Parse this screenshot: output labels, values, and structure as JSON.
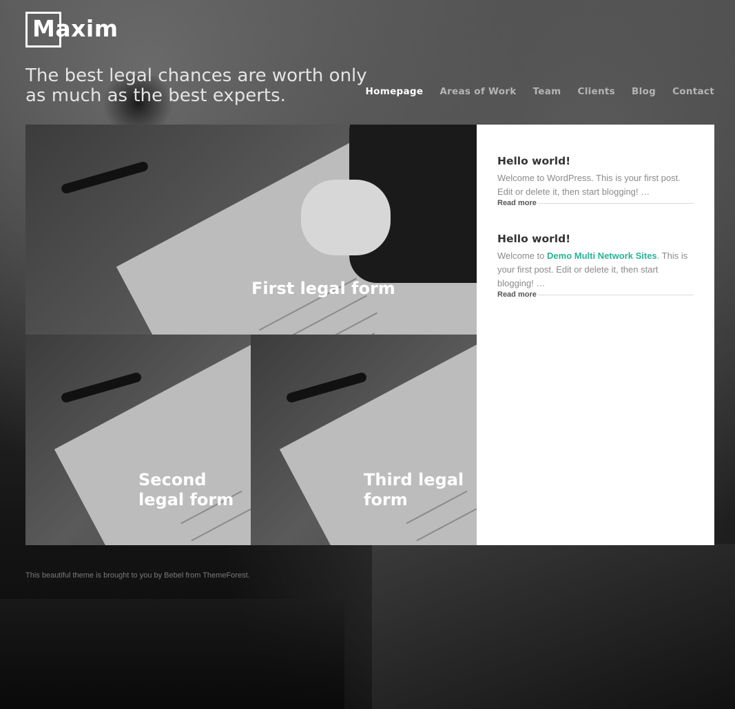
{
  "site": {
    "logo_text": "Maxim",
    "tagline": "The best legal chances are worth only as much as the best experts."
  },
  "nav": {
    "items": [
      {
        "label": "Homepage",
        "active": true
      },
      {
        "label": "Areas of Work",
        "active": false
      },
      {
        "label": "Team",
        "active": false
      },
      {
        "label": "Clients",
        "active": false
      },
      {
        "label": "Blog",
        "active": false
      },
      {
        "label": "Contact",
        "active": false
      }
    ]
  },
  "tiles": [
    {
      "title": "First legal form"
    },
    {
      "title": "Second legal form"
    },
    {
      "title": "Third legal form"
    }
  ],
  "sidebar": {
    "posts": [
      {
        "title": "Hello world!",
        "excerpt": "Welcome to WordPress. This is your first post. Edit or delete it, then start blogging! …",
        "read_more": "Read more"
      },
      {
        "title": "Hello world!",
        "excerpt_prefix": "Welcome to ",
        "excerpt_link": "Demo Multi Network Sites",
        "excerpt_suffix": ". This is your first post. Edit or delete it, then start blogging! …",
        "read_more": "Read more"
      }
    ]
  },
  "footer": {
    "text": "This beautiful theme is brought to you by Bebel from ThemeForest."
  },
  "colors": {
    "accent": "#27b394",
    "nav_active": "#ffffff",
    "nav_inactive": "#b5b5b5"
  }
}
